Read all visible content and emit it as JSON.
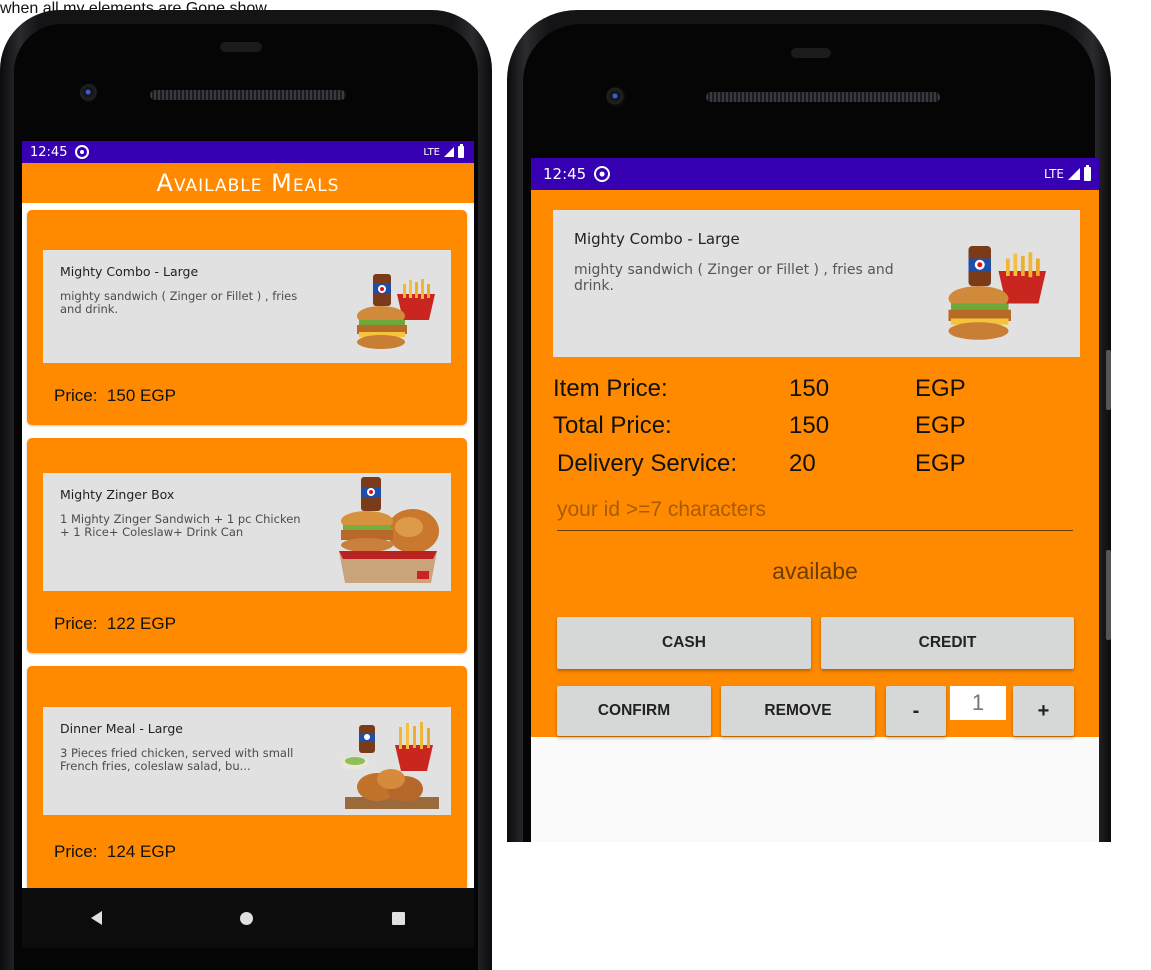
{
  "caption": "when all my elements are Gone show",
  "left_screen": {
    "status_bar": {
      "time": "12:45",
      "network": "LTE"
    },
    "app_bar": {
      "title": "Available Meals"
    },
    "meals": [
      {
        "title": "Mighty Combo - Large",
        "description": "mighty sandwich ( Zinger or Fillet ) , fries and drink.",
        "price_label": "Price:",
        "price": "150 EGP"
      },
      {
        "title": "Mighty Zinger Box",
        "description": "1 Mighty Zinger Sandwich + 1 pc Chicken + 1 Rice+ Coleslaw+ Drink Can",
        "price_label": "Price:",
        "price": "122 EGP"
      },
      {
        "title": "Dinner Meal - Large",
        "description": "3 Pieces fried chicken, served with small French fries, coleslaw salad, bu...",
        "price_label": "Price:",
        "price": "124 EGP"
      }
    ]
  },
  "right_screen": {
    "status_bar": {
      "time": "12:45",
      "network": "LTE"
    },
    "item": {
      "title": "Mighty Combo - Large",
      "description": "mighty sandwich ( Zinger or Fillet ) , fries and drink."
    },
    "rows": [
      {
        "label": "Item Price:",
        "value": "150",
        "unit": "EGP"
      },
      {
        "label": "Total Price:",
        "value": "150",
        "unit": "EGP"
      },
      {
        "label": "Delivery Service:",
        "value": "20",
        "unit": "EGP"
      }
    ],
    "id_input": {
      "value": "",
      "placeholder": "your id >=7 characters"
    },
    "availability": "availabe",
    "buttons": {
      "cash": "CASH",
      "credit": "CREDIT",
      "confirm": "CONFIRM",
      "remove": "REMOVE",
      "minus": "-",
      "plus": "+"
    },
    "quantity": "1"
  },
  "colors": {
    "primary": "#ff8a00",
    "status_bar": "#3700b3",
    "card": "#e1e1e1",
    "button": "#d6d7d7"
  }
}
